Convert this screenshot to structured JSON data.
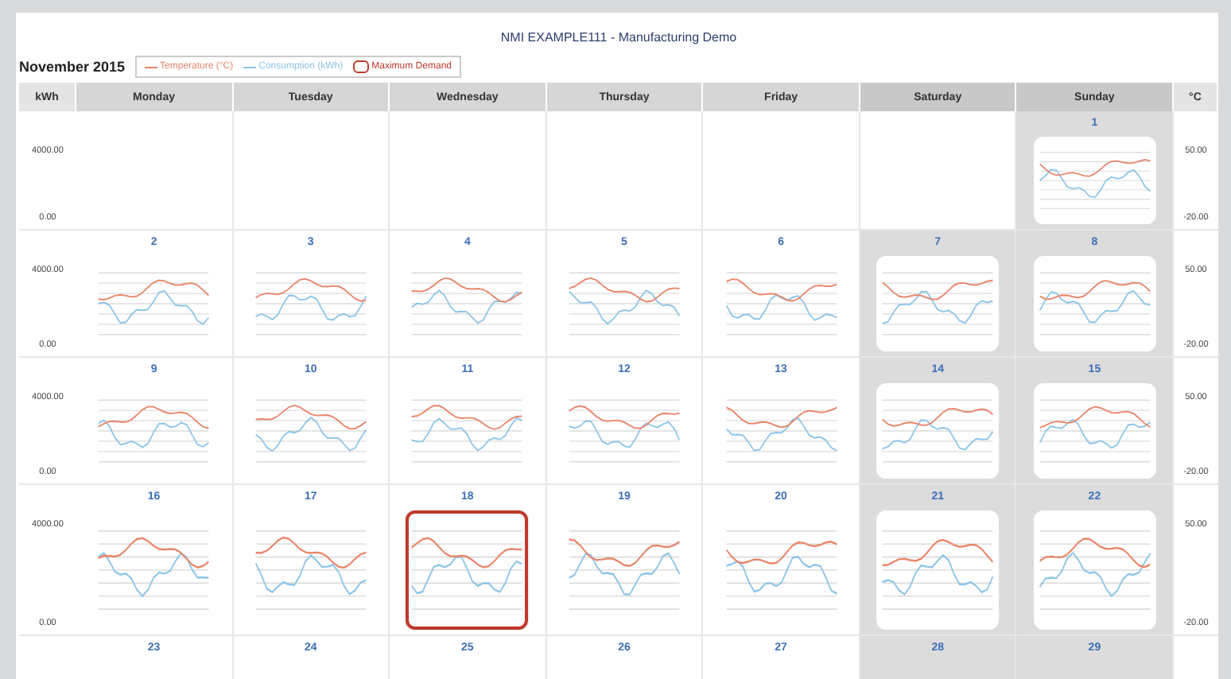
{
  "title": "NMI EXAMPLE111 - Manufacturing Demo",
  "month": "November 2015",
  "legend": [
    {
      "label": "Temperature (°C)",
      "kind": "line",
      "color": "#e8866a"
    },
    {
      "label": "Consumption (kWh)",
      "kind": "line",
      "color": "#8cc4e8"
    },
    {
      "label": "Maximum Demand",
      "kind": "ring",
      "color": "#c0392b"
    }
  ],
  "left_axis_header": "kWh",
  "right_axis_header": "°C",
  "columns": [
    {
      "label": "Monday",
      "weekend": false
    },
    {
      "label": "Tuesday",
      "weekend": false
    },
    {
      "label": "Wednesday",
      "weekend": false
    },
    {
      "label": "Thursday",
      "weekend": false
    },
    {
      "label": "Friday",
      "weekend": false
    },
    {
      "label": "Saturday",
      "weekend": true
    },
    {
      "label": "Sunday",
      "weekend": true
    }
  ],
  "weeks": [
    {
      "kwh_labels": [
        "4000.00",
        "0.00"
      ],
      "temp_labels": [
        "50.00",
        "-20.00"
      ],
      "days": [
        {
          "kind": "empty"
        },
        {
          "kind": "empty"
        },
        {
          "kind": "empty"
        },
        {
          "kind": "empty"
        },
        {
          "kind": "empty"
        },
        {
          "kind": "empty"
        },
        {
          "kind": "day",
          "day": "1",
          "max_demand": false
        }
      ]
    },
    {
      "kwh_labels": [
        "4000.00",
        "0.00"
      ],
      "temp_labels": [
        "50.00",
        "-20.00"
      ],
      "days": [
        {
          "kind": "day",
          "day": "2",
          "max_demand": false
        },
        {
          "kind": "day",
          "day": "3",
          "max_demand": false
        },
        {
          "kind": "day",
          "day": "4",
          "max_demand": false
        },
        {
          "kind": "day",
          "day": "5",
          "max_demand": false
        },
        {
          "kind": "day",
          "day": "6",
          "max_demand": false
        },
        {
          "kind": "day",
          "day": "7",
          "max_demand": false
        },
        {
          "kind": "day",
          "day": "8",
          "max_demand": false
        }
      ]
    },
    {
      "kwh_labels": [
        "4000.00",
        "0.00"
      ],
      "temp_labels": [
        "50.00",
        "-20.00"
      ],
      "days": [
        {
          "kind": "day",
          "day": "9",
          "max_demand": false
        },
        {
          "kind": "day",
          "day": "10",
          "max_demand": false
        },
        {
          "kind": "day",
          "day": "11",
          "max_demand": false
        },
        {
          "kind": "day",
          "day": "12",
          "max_demand": false
        },
        {
          "kind": "day",
          "day": "13",
          "max_demand": false
        },
        {
          "kind": "day",
          "day": "14",
          "max_demand": false
        },
        {
          "kind": "day",
          "day": "15",
          "max_demand": false
        }
      ]
    },
    {
      "kwh_labels": [
        "4000.00",
        "0.00"
      ],
      "temp_labels": [
        "50.00",
        "-20.00"
      ],
      "days": [
        {
          "kind": "day",
          "day": "16",
          "max_demand": false
        },
        {
          "kind": "day",
          "day": "17",
          "max_demand": false
        },
        {
          "kind": "day",
          "day": "18",
          "max_demand": true
        },
        {
          "kind": "day",
          "day": "19",
          "max_demand": false
        },
        {
          "kind": "day",
          "day": "20",
          "max_demand": false
        },
        {
          "kind": "day",
          "day": "21",
          "max_demand": false
        },
        {
          "kind": "day",
          "day": "22",
          "max_demand": false
        }
      ]
    },
    {
      "days": [
        {
          "kind": "number",
          "day": "23"
        },
        {
          "kind": "number",
          "day": "24"
        },
        {
          "kind": "number",
          "day": "25"
        },
        {
          "kind": "number",
          "day": "26"
        },
        {
          "kind": "number",
          "day": "27"
        },
        {
          "kind": "number",
          "day": "28"
        },
        {
          "kind": "number",
          "day": "29"
        }
      ]
    }
  ]
}
